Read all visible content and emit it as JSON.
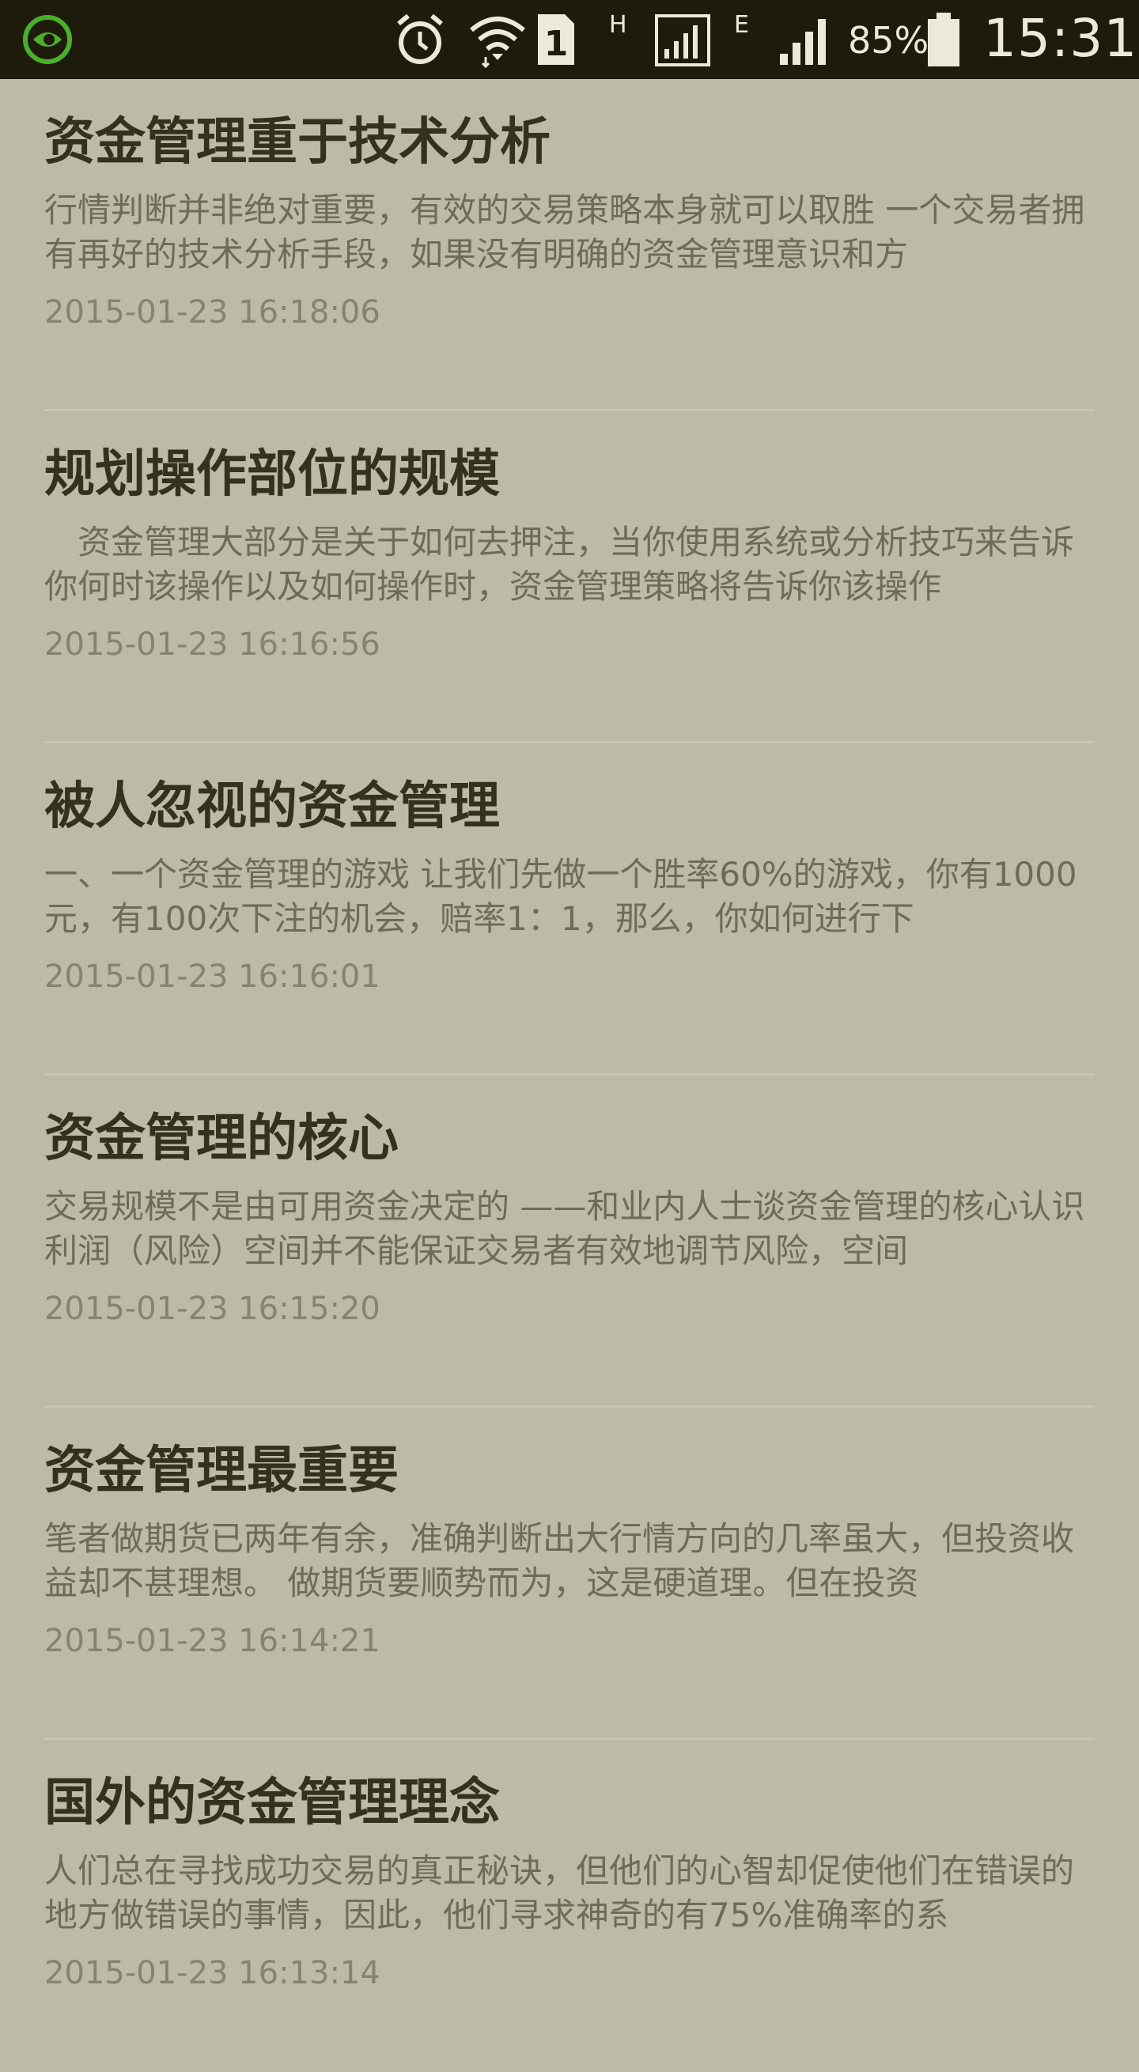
{
  "status_bar": {
    "network_h": "H",
    "network_e": "E",
    "sim_slot": "1",
    "battery_percent": "85%",
    "time": "15:31",
    "icons": [
      "app-notification-icon",
      "alarm-icon",
      "wifi-icon",
      "sim1-icon",
      "signal-h-icon",
      "signal-e-icon",
      "battery-icon"
    ]
  },
  "articles": [
    {
      "title": "资金管理重于技术分析",
      "summary": "行情判断并非绝对重要，有效的交易策略本身就可以取胜 一个交易者拥有再好的技术分析手段，如果没有明确的资金管理意识和方",
      "time": "2015-01-23 16:18:06"
    },
    {
      "title": "规划操作部位的规模",
      "summary": "　资金管理大部分是关于如何去押注，当你使用系统或分析技巧来告诉你何时该操作以及如何操作时，资金管理策略将告诉你该操作",
      "time": "2015-01-23 16:16:56"
    },
    {
      "title": "被人忽视的资金管理",
      "summary": "一、一个资金管理的游戏 让我们先做一个胜率60%的游戏，你有1000元，有100次下注的机会，赔率1：1，那么，你如何进行下",
      "time": "2015-01-23 16:16:01"
    },
    {
      "title": "资金管理的核心",
      "summary": "交易规模不是由可用资金决定的 ——和业内人士谈资金管理的核心认识利润（风险）空间并不能保证交易者有效地调节风险，空间",
      "time": "2015-01-23 16:15:20"
    },
    {
      "title": "资金管理最重要",
      "summary": "笔者做期货已两年有余，准确判断出大行情方向的几率虽大，但投资收益却不甚理想。 做期货要顺势而为，这是硬道理。但在投资",
      "time": "2015-01-23 16:14:21"
    },
    {
      "title": "国外的资金管理理念",
      "summary": "人们总在寻找成功交易的真正秘诀，但他们的心智却促使他们在错误的地方做错误的事情，因此，他们寻求神奇的有75%准确率的系",
      "time": "2015-01-23 16:13:14"
    }
  ]
}
